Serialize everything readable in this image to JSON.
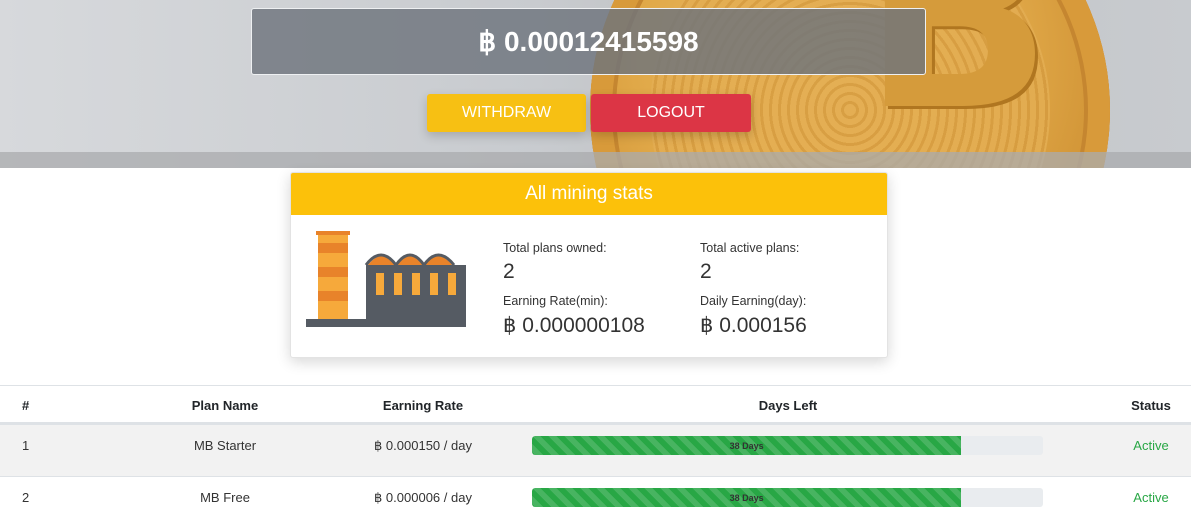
{
  "balance": {
    "text": "฿ 0.00012415598"
  },
  "actions": {
    "withdraw_label": "WITHDRAW",
    "logout_label": "LOGOUT"
  },
  "colors": {
    "withdraw": "#f7c013",
    "logout": "#dc3545",
    "card_header": "#fcc10a",
    "progress": "#28a745",
    "status_active": "#28a745"
  },
  "stats_card": {
    "title": "All mining stats",
    "icon": "factory-icon",
    "stats": [
      {
        "label": "Total plans owned:",
        "value": "2"
      },
      {
        "label": "Total active plans:",
        "value": "2"
      },
      {
        "label": "Earning Rate(min):",
        "value": "฿ 0.000000108"
      },
      {
        "label": "Daily Earning(day):",
        "value": "฿ 0.000156"
      }
    ]
  },
  "table": {
    "headers": {
      "num": "#",
      "plan": "Plan Name",
      "rate": "Earning Rate",
      "days": "Days Left",
      "status": "Status"
    },
    "rows": [
      {
        "num": "1",
        "plan": "MB Starter",
        "rate": "฿ 0.000150 / day",
        "days_label": "38 Days",
        "progress": 0.84,
        "status": "Active"
      },
      {
        "num": "2",
        "plan": "MB Free",
        "rate": "฿ 0.000006 / day",
        "days_label": "38 Days",
        "progress": 0.84,
        "status": "Active"
      }
    ]
  }
}
